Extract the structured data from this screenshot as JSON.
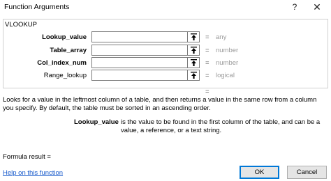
{
  "window": {
    "title": "Function Arguments",
    "help_glyph": "?",
    "close_glyph": "✕"
  },
  "function_name": "VLOOKUP",
  "arguments": [
    {
      "label": "Lookup_value",
      "bold": true,
      "value": "",
      "equals": "=",
      "hint": "any"
    },
    {
      "label": "Table_array",
      "bold": true,
      "value": "",
      "equals": "=",
      "hint": "number"
    },
    {
      "label": "Col_index_num",
      "bold": true,
      "value": "",
      "equals": "=",
      "hint": "number"
    },
    {
      "label": "Range_lookup",
      "bold": false,
      "value": "",
      "equals": "=",
      "hint": "logical"
    }
  ],
  "result_equals": "=",
  "description": "Looks for a value in the leftmost column of a table, and then returns a value in the same row from a column you specify. By default, the table must be sorted in an ascending order.",
  "arg_description": {
    "name": "Lookup_value",
    "text": "is the value to be found in the first column of the table, and can be a value, a reference, or a text string."
  },
  "formula_result_label": "Formula result =",
  "help_link": "Help on this function",
  "buttons": {
    "ok": "OK",
    "cancel": "Cancel"
  },
  "icons": {
    "ref_button": "collapse-dialog-arrow-icon"
  }
}
